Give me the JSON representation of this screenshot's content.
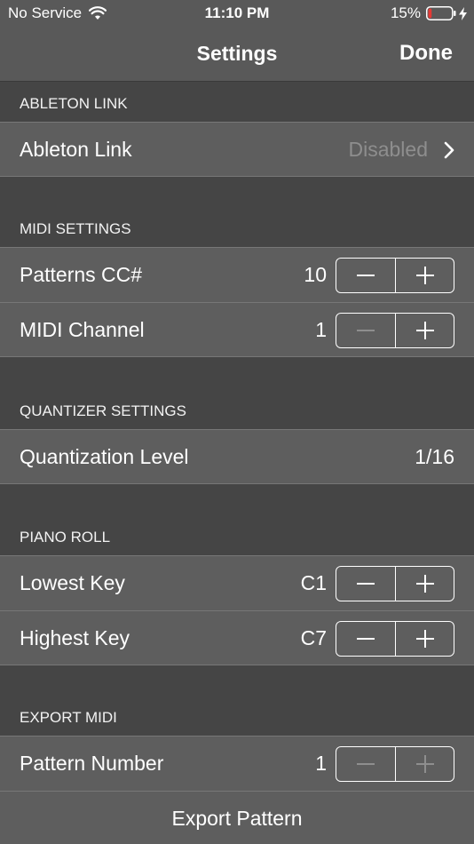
{
  "status": {
    "carrier": "No Service",
    "time": "11:10 PM",
    "battery": "15%",
    "battery_level": 0.15,
    "battery_color": "#e53935"
  },
  "nav": {
    "title": "Settings",
    "done_label": "Done"
  },
  "sections": {
    "ableton": {
      "header": "ABLETON LINK",
      "link": {
        "label": "Ableton Link",
        "value": "Disabled"
      }
    },
    "midi": {
      "header": "MIDI SETTINGS",
      "patterns_cc": {
        "label": "Patterns CC#",
        "value": "10"
      },
      "channel": {
        "label": "MIDI Channel",
        "value": "1"
      }
    },
    "quantizer": {
      "header": "QUANTIZER SETTINGS",
      "level": {
        "label": "Quantization Level",
        "value": "1/16"
      }
    },
    "piano_roll": {
      "header": "PIANO ROLL",
      "lowest": {
        "label": "Lowest Key",
        "value": "C1"
      },
      "highest": {
        "label": "Highest Key",
        "value": "C7"
      }
    },
    "export": {
      "header": "EXPORT MIDI",
      "pattern_number": {
        "label": "Pattern Number",
        "value": "1"
      },
      "export_label": "Export Pattern"
    }
  }
}
